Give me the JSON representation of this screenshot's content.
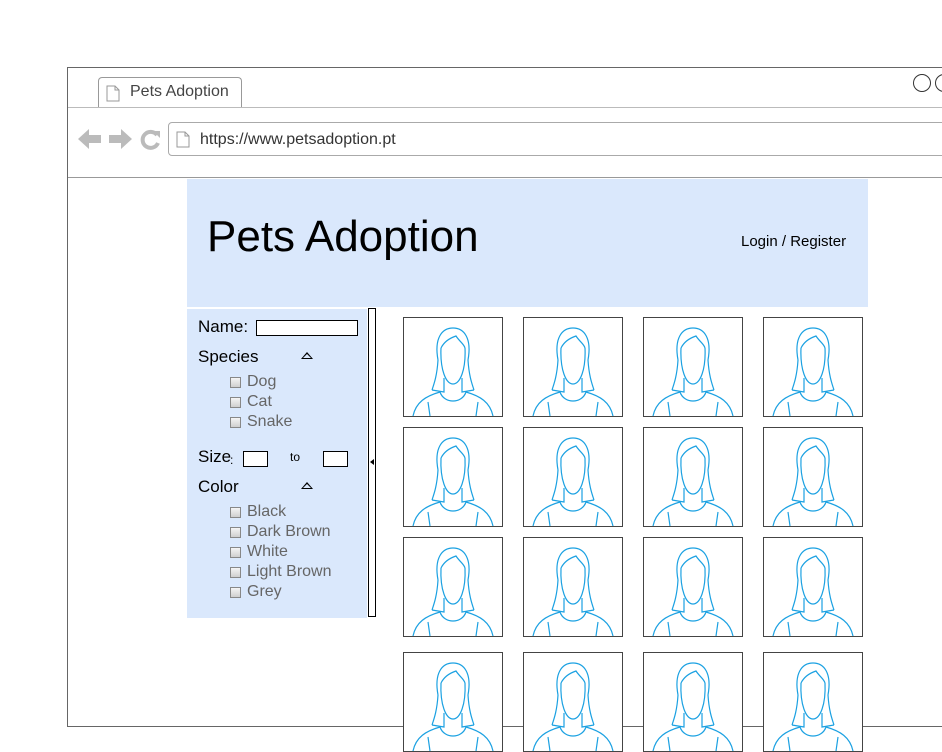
{
  "browser": {
    "tab_title": "Pets Adoption",
    "url": "https://www.petsadoption.pt"
  },
  "header": {
    "title": "Pets Adoption",
    "login_link": "Login / Register"
  },
  "filters": {
    "name_label": "Name:",
    "name_value": "",
    "species_label": "Species",
    "species_options": [
      "Dog",
      "Cat",
      "Snake"
    ],
    "size_label": "Size",
    "size_colon": ":",
    "size_to": "to",
    "size_from_value": "",
    "size_to_value": "",
    "color_label": "Color",
    "color_options": [
      "Black",
      "Dark Brown",
      "White",
      "Light Brown",
      "Grey"
    ]
  },
  "grid": {
    "columns": 4,
    "rows_visible": 4,
    "item_icon": "person-placeholder-icon"
  },
  "colors": {
    "panel_bg": "#dae8fc",
    "icon_stroke": "#1ba1e2"
  }
}
